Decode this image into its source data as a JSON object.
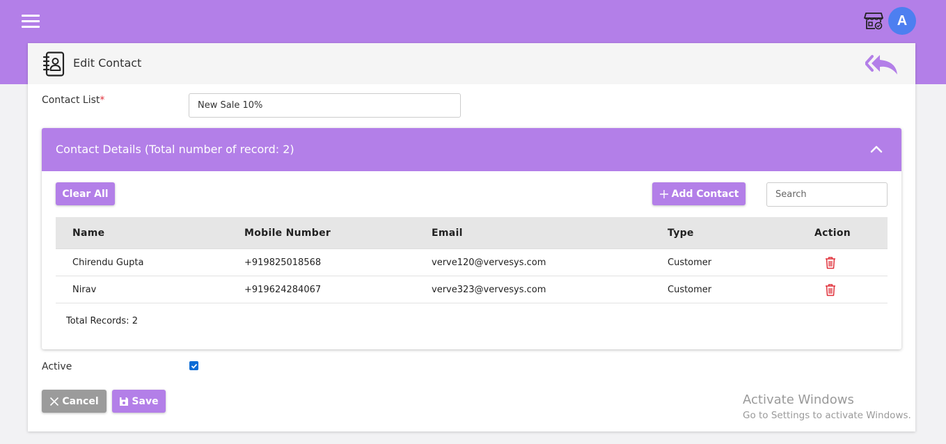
{
  "header": {
    "avatar_letter": "A",
    "icons": {
      "menu": "hamburger-icon",
      "store": "store-icon"
    },
    "color": "#b37fe8"
  },
  "card": {
    "title": "Edit Contact",
    "icons": {
      "title": "contact-book-icon",
      "back": "double-reply-back-icon"
    }
  },
  "form": {
    "contact_list_label": "Contact List",
    "required_mark": "*",
    "contact_list_value": "New Sale 10%",
    "active_label": "Active",
    "active_checked": true
  },
  "contact_details": {
    "title": "Contact Details (Total number of record: 2)",
    "clear_all_label": "Clear All",
    "add_contact_label": "Add Contact",
    "search_placeholder": "Search",
    "columns": [
      "Name",
      "Mobile Number",
      "Email",
      "Type",
      "Action"
    ],
    "rows": [
      {
        "name": "Chirendu Gupta",
        "mobile": "+919825018568",
        "email": "verve120@vervesys.com",
        "type": "Customer",
        "action_icon": "trash-icon"
      },
      {
        "name": "Nirav",
        "mobile": "+919624284067",
        "email": "verve323@vervesys.com",
        "type": "Customer",
        "action_icon": "trash-icon"
      }
    ],
    "total_records": "Total Records: 2"
  },
  "buttons": {
    "cancel_label": "Cancel",
    "save_label": "Save",
    "cancel_color": "#9b9b9b",
    "primary_color": "#b37fe8"
  },
  "watermark": {
    "title": "Activate Windows",
    "subtitle": "Go to Settings to activate Windows."
  }
}
